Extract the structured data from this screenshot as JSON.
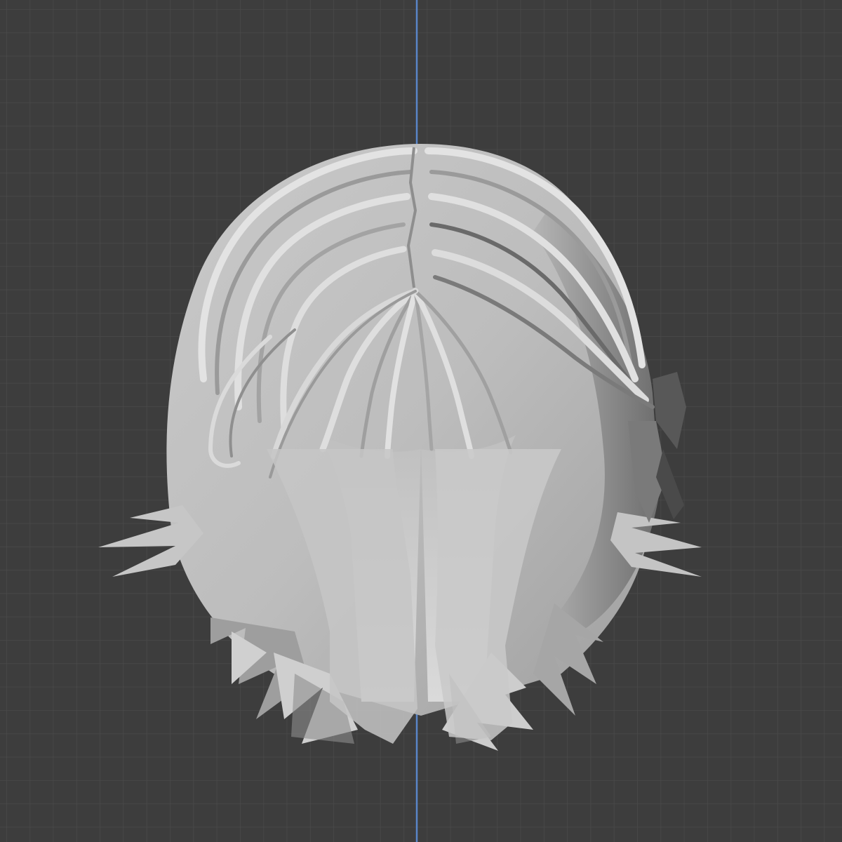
{
  "viewport": {
    "view": "front",
    "object": "hair-mesh",
    "shading": "solid",
    "colors": {
      "background": "#3d3d3d",
      "grid_minor": "#4a4a4a",
      "grid_major": "#535353",
      "z_axis": "#5a86c9",
      "mesh_light": "#d2d2d2",
      "mesh_mid": "#a9a9a9",
      "mesh_dark": "#5e5e5e",
      "bow": "#585858"
    }
  }
}
